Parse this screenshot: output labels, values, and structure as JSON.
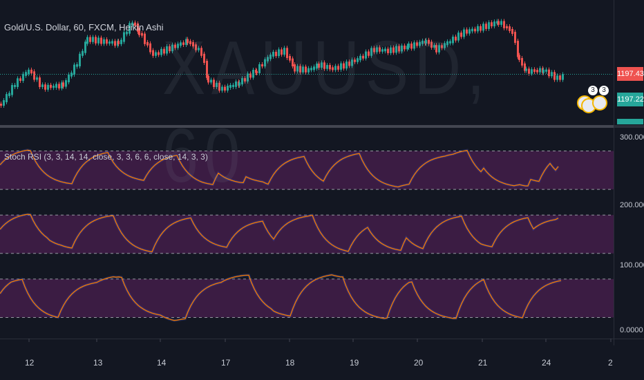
{
  "header": {
    "symbol_title": "Gold/U.S. Dollar, 60, FXCM, Heikin Ashi",
    "watermark": "XAUUSD, 60"
  },
  "indicator": {
    "title": "Stoch RSI (3, 3, 14, 14, close, 3, 3, 6, 6, close, 14, 3, 3)"
  },
  "price_scale": {
    "tag_current": "1197.43",
    "tag_second": "1197.22"
  },
  "indicator_scale": {
    "labels": [
      "300.0000",
      "200.0000",
      "100.0000",
      "0.0000"
    ]
  },
  "time_axis": {
    "labels": [
      "12",
      "13",
      "14",
      "17",
      "18",
      "19",
      "20",
      "21",
      "24",
      "2"
    ]
  },
  "events": {
    "badge1_count": "3",
    "badge2_count": "3"
  },
  "colors": {
    "background": "#131722",
    "up_candle": "#26a69a",
    "down_candle": "#ef5350",
    "stoch_line": "#f57c00",
    "band_fill": "#4a1f4f",
    "price_line": "#26a69a"
  },
  "chart_data": [
    {
      "type": "candlestick",
      "title": "Gold/U.S. Dollar, 60, FXCM, Heikin Ashi",
      "x_labels": [
        "12",
        "13",
        "14",
        "17",
        "18",
        "19",
        "20",
        "21",
        "24"
      ],
      "y_last": 1197.43
    },
    {
      "type": "line",
      "title": "Stoch RSI (3, 3, 14, 14, close, 3, 3, 6, 6, close, 14, 3, 3)",
      "ylim": [
        0,
        300
      ],
      "ticks": [
        300,
        200,
        100,
        0
      ],
      "bands": [
        [
          220,
          280
        ],
        [
          120,
          180
        ],
        [
          20,
          80
        ]
      ]
    }
  ]
}
